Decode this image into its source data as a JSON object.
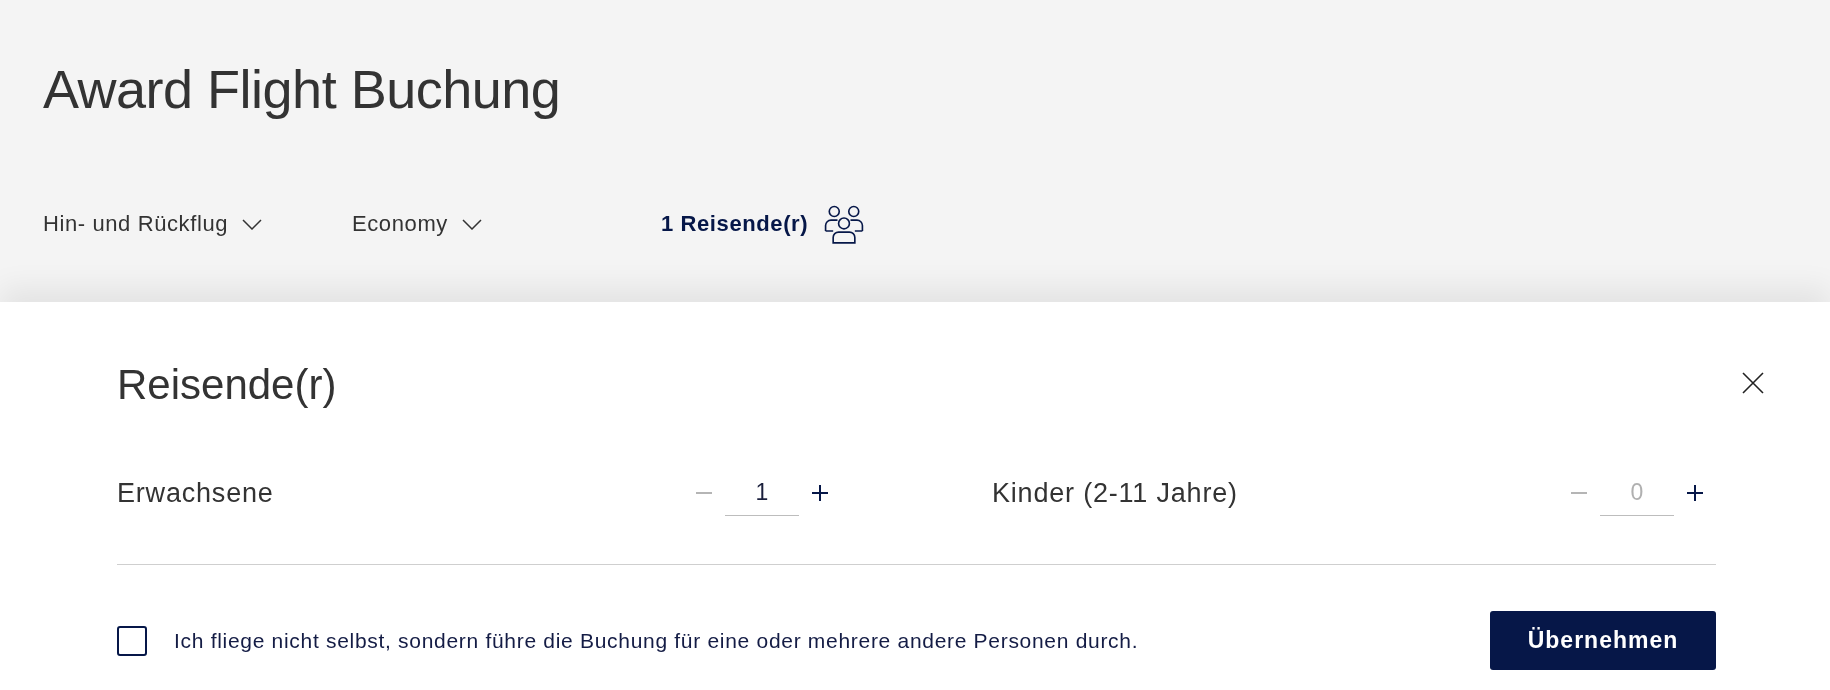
{
  "header": {
    "title": "Award Flight Buchung",
    "filters": [
      {
        "kind": "dropdown",
        "label": "Hin- und Rückflug",
        "selected": false
      },
      {
        "kind": "dropdown",
        "label": "Economy",
        "selected": false
      },
      {
        "kind": "travelers",
        "label": "1 Reisende(r)",
        "selected": true
      }
    ]
  },
  "dialog": {
    "title": "Reisende(r)",
    "counters": [
      {
        "label": "Erwachsene",
        "value": "1",
        "value_muted": false,
        "minus_disabled": true,
        "plus_disabled": false
      },
      {
        "label": "Kinder (2-11 Jahre)",
        "value": "0",
        "value_muted": true,
        "minus_disabled": true,
        "plus_disabled": false
      }
    ],
    "checkbox": {
      "label": "Ich fliege nicht selbst, sondern führe die Buchung für eine oder mehrere andere Personen durch.",
      "checked": false
    },
    "button": "Übernehmen"
  }
}
